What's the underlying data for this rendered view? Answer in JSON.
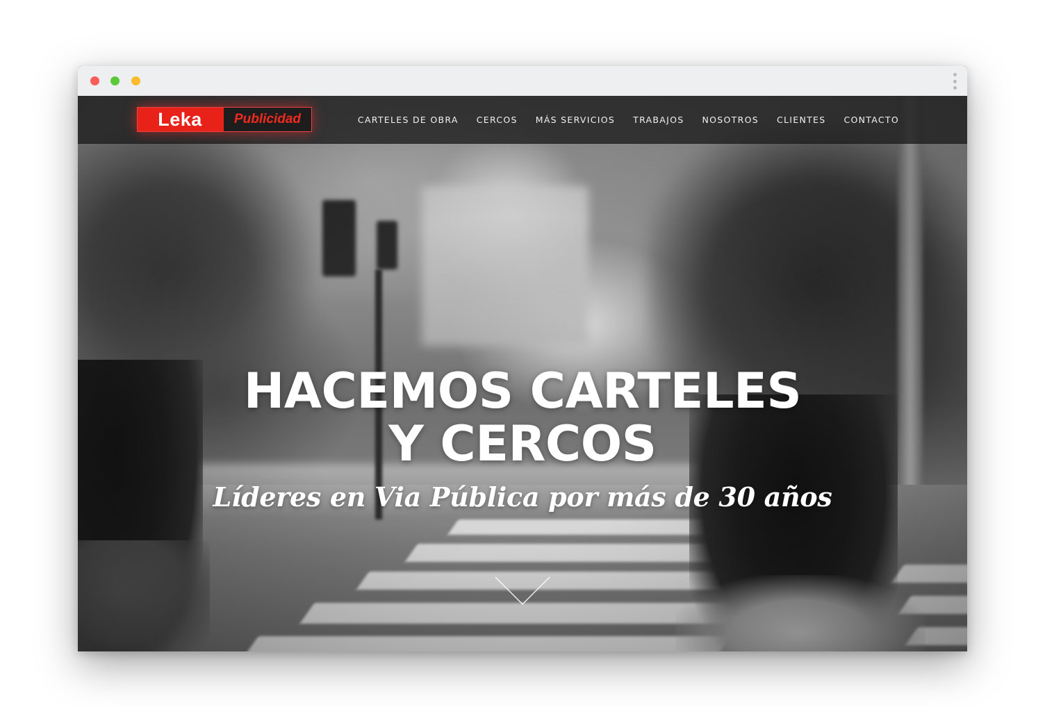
{
  "brand": {
    "name_primary": "Leka",
    "name_secondary": "Publicidad",
    "primary_color": "#e82218"
  },
  "nav": {
    "items": [
      {
        "label": "CARTELES DE OBRA"
      },
      {
        "label": "CERCOS"
      },
      {
        "label": "MÁS SERVICIOS"
      },
      {
        "label": "TRABAJOS"
      },
      {
        "label": "NOSOTROS"
      },
      {
        "label": "CLIENTES"
      },
      {
        "label": "CONTACTO"
      }
    ]
  },
  "hero": {
    "headline_line1": "HACEMOS CARTELES",
    "headline_line2": "Y CERCOS",
    "tagline": "Líderes en Via Pública por más de 30 años",
    "scroll_icon": "chevron-down-icon"
  },
  "window": {
    "controls": [
      "close",
      "minimize",
      "maximize"
    ],
    "menu_icon": "kebab-menu-icon"
  }
}
